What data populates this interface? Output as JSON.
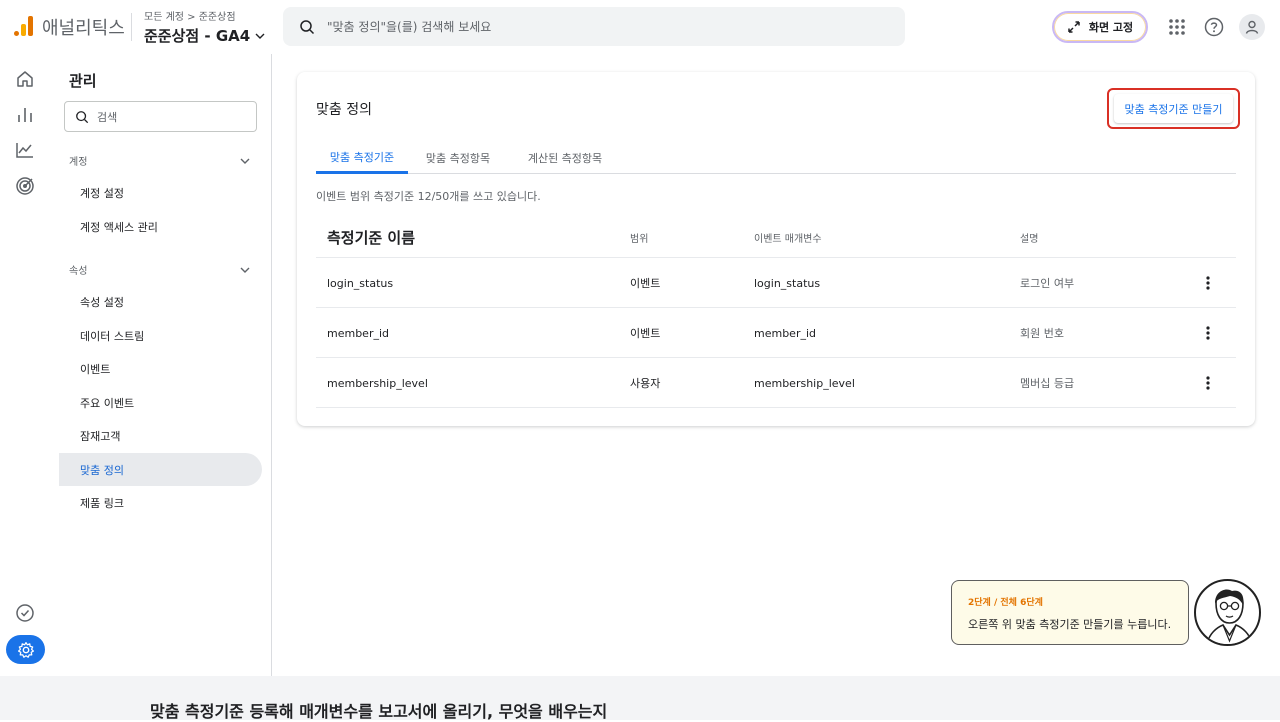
{
  "app": {
    "name": "애널리틱스"
  },
  "header": {
    "breadcrumb_account": "모든 계정",
    "breadcrumb_property": "준준상점",
    "property_selector": "준준상점 - GA4",
    "search_placeholder": "\"맞춤 정의\"을(를) 검색해 보세요",
    "pin_label": "화면 고정"
  },
  "icons": {
    "apps": "apps-grid-icon",
    "help": "help-icon",
    "account": "account-icon"
  },
  "rail": {
    "items": [
      "home-icon",
      "reports-icon",
      "explore-icon",
      "advertising-icon"
    ],
    "bottom": [
      "check-circle-icon",
      "settings-icon"
    ]
  },
  "sidenav": {
    "title": "관리",
    "search_placeholder": "검색",
    "sections": [
      {
        "label": "계정",
        "items": [
          "계정 설정",
          "계정 액세스 관리"
        ]
      },
      {
        "label": "속성",
        "items": [
          "속성 설정",
          "데이터 스트림",
          "이벤트",
          "주요 이벤트",
          "잠재고객",
          "맞춤 정의",
          "제품 링크"
        ]
      }
    ],
    "active_item": "맞춤 정의"
  },
  "main": {
    "title": "맞춤 정의",
    "create_button": "맞춤 측정기준 만들기",
    "tabs": [
      "맞춤 측정기준",
      "맞춤 측정항목",
      "계산된 측정항목"
    ],
    "active_tab": 0,
    "usage_text": "이벤트 범위 측정기준 12/50개를 쓰고 있습니다.",
    "columns": [
      "측정기준 이름",
      "범위",
      "이벤트 매개변수",
      "설명"
    ],
    "rows": [
      {
        "name": "login_status",
        "scope": "이벤트",
        "param": "login_status",
        "desc": "로그인 여부"
      },
      {
        "name": "member_id",
        "scope": "이벤트",
        "param": "member_id",
        "desc": "회원 번호"
      },
      {
        "name": "membership_level",
        "scope": "사용자",
        "param": "membership_level",
        "desc": "멤버십 등급"
      }
    ]
  },
  "guide": {
    "step": "2단계 / 전체 6단계",
    "text": "오른쪽 위 맞춤 측정기준 만들기를 누릅니다."
  },
  "footer": {
    "text": "맞춤 측정기준 등록해 매개변수를 보고서에 올리기, 무엇을 배우는지"
  },
  "colors": {
    "accent": "#1a73e8",
    "highlight": "#d93025",
    "logo_orange": "#e37400",
    "logo_yellow": "#f9ab00",
    "guide_bg": "#fefbe8"
  }
}
